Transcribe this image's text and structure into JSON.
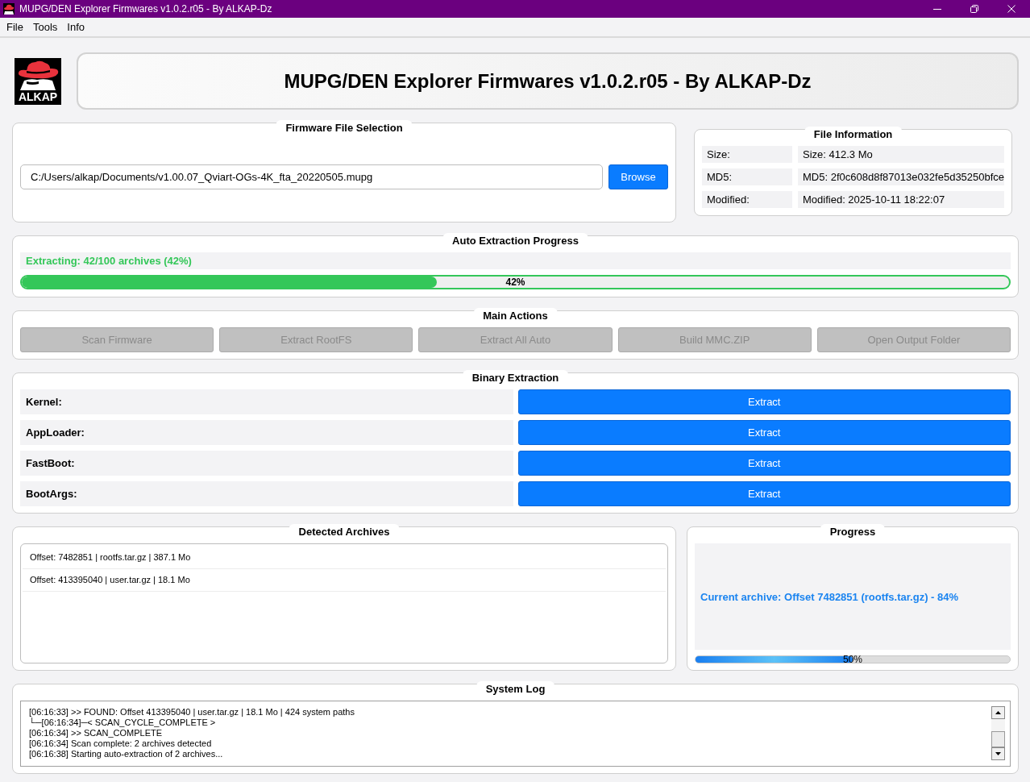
{
  "window": {
    "title": "MUPG/DEN Explorer Firmwares v1.0.2.r05 - By ALKAP-Dz"
  },
  "menu": [
    "File",
    "Tools",
    "Info"
  ],
  "header": {
    "logo_text": "ALKAP",
    "title": "MUPG/DEN Explorer Firmwares v1.0.2.r05 - By ALKAP-Dz"
  },
  "file_selection": {
    "title": "Firmware File Selection",
    "path": "C:/Users/alkap/Documents/v1.00.07_Qviart-OGs-4K_fta_20220505.mupg",
    "button": "Browse"
  },
  "file_info": {
    "title": "File Information",
    "rows": [
      {
        "label": "Size:",
        "value": "Size: 412.3 Mo"
      },
      {
        "label": "MD5:",
        "value": "MD5: 2f0c608d8f87013e032fe5d35250bfce"
      },
      {
        "label": "Modified:",
        "value": "Modified: 2025-10-11 18:22:07"
      }
    ]
  },
  "auto_extraction": {
    "title": "Auto Extraction Progress",
    "status": "Extracting: 42/100 archives (42%)",
    "level": 0.42,
    "reading": "42%"
  },
  "main_actions": {
    "title": "Main Actions",
    "buttons": [
      {
        "label": "Scan Firmware",
        "disabled": true
      },
      {
        "label": "Extract RootFS",
        "disabled": true
      },
      {
        "label": "Extract All Auto",
        "disabled": true
      },
      {
        "label": "Build MMC.ZIP",
        "disabled": true
      },
      {
        "label": "Open Output Folder",
        "disabled": true
      }
    ]
  },
  "binary_extraction": {
    "title": "Binary Extraction",
    "rows": [
      {
        "label": "Kernel:",
        "button": "Extract"
      },
      {
        "label": "AppLoader:",
        "button": "Extract"
      },
      {
        "label": "FastBoot:",
        "button": "Extract"
      },
      {
        "label": "BootArgs:",
        "button": "Extract"
      }
    ]
  },
  "detected_archives": {
    "title": "Detected Archives",
    "items": [
      {
        "text": "Offset: 7482851 | rootfs.tar.gz | 387.1 Mo",
        "selected": false
      },
      {
        "text": "Offset: 413395040 | user.tar.gz | 18.1 Mo",
        "selected": false
      }
    ]
  },
  "progress": {
    "title": "Progress",
    "current": "Current archive: Offset 7482851 (rootfs.tar.gz) - 84%",
    "level": 0.5,
    "reading": "50%"
  },
  "system_log": {
    "title": "System Log",
    "lines": [
      "[06:16:33] >> FOUND: Offset 413395040 | user.tar.gz | 18.1 Mo | 424 system paths",
      "└─[06:16:34]─< SCAN_CYCLE_COMPLETE >",
      "[06:16:34] >> SCAN_COMPLETE",
      "[06:16:34] Scan complete: 2 archives detected",
      "[06:16:38] Starting auto-extraction of 2 archives..."
    ]
  }
}
